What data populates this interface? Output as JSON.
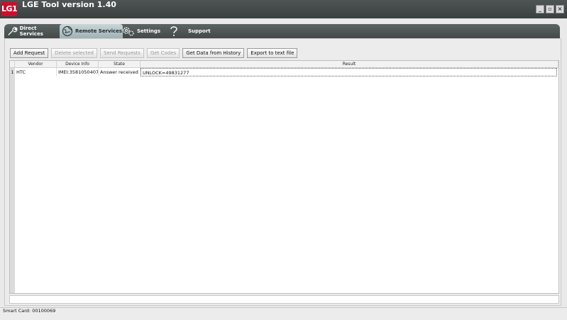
{
  "window": {
    "logo_text": "LG1",
    "title": "LGE Tool version 1.40"
  },
  "nav": {
    "items": [
      {
        "label": "Direct Services",
        "icon": "wrench-icon",
        "active": false
      },
      {
        "label": "Remote Services",
        "icon": "globe-icon",
        "active": true
      },
      {
        "label": "Settings",
        "icon": "gears-icon",
        "active": false
      },
      {
        "label": "Support",
        "icon": "question-icon",
        "active": false
      }
    ]
  },
  "toolbar": {
    "add_request": "Add Request",
    "delete_selected": "Delete selected",
    "send_requests": "Send Requests",
    "get_codes": "Get Codes",
    "get_data_history": "Get Data from History",
    "export_text": "Export to text file"
  },
  "table": {
    "columns": [
      "Vendor",
      "Device Info",
      "State",
      "Result"
    ],
    "rows": [
      {
        "num": "1",
        "vendor": "HTC",
        "device_info": "IMEI:3581050407...",
        "state": "Answer received",
        "result": "UNLOCK=49831277"
      }
    ]
  },
  "status": {
    "text": "Smart Card: 00100069"
  },
  "colors": {
    "titlebar": "#3e4443",
    "accent_red": "#c8102e",
    "active_tab": "#b7c6ca"
  }
}
